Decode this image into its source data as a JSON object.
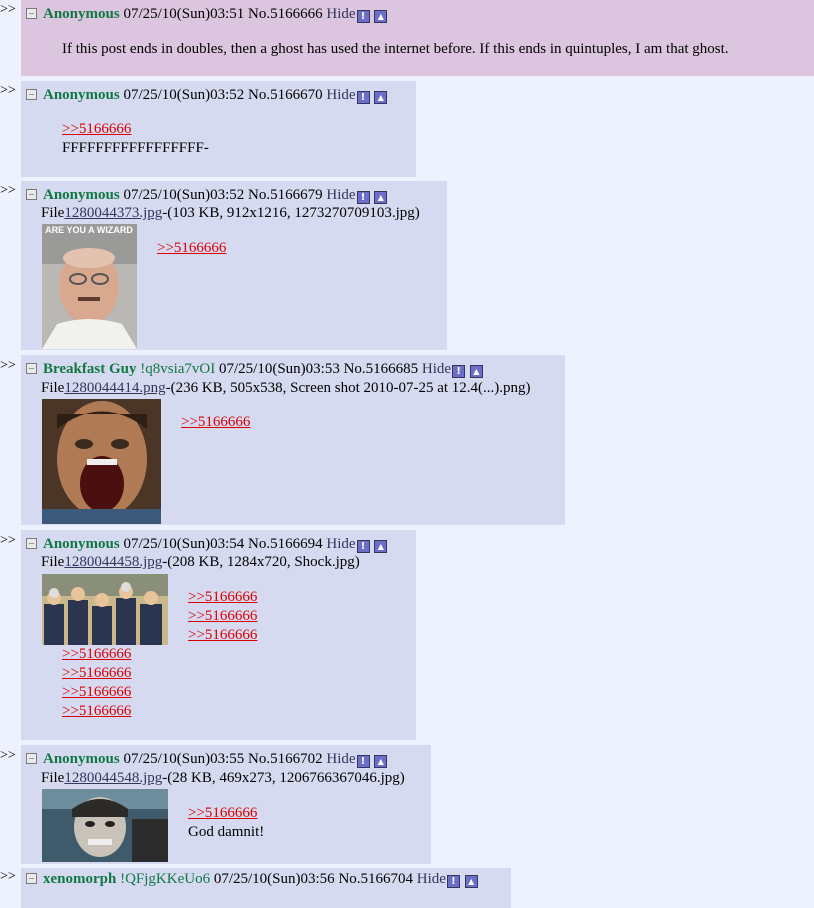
{
  "arrow": ">>",
  "hide_label": "Hide",
  "file_prefix": "File",
  "icons": {
    "report": "report-icon",
    "quick_reply": "quick-reply-icon",
    "checkbox": "delete-checkbox"
  },
  "posts": [
    {
      "name": "Anonymous",
      "date": "07/25/10(Sun)03:51",
      "no": "No.5166666",
      "lines": [
        "If this post ends in doubles, then a ghost has used the internet before. If this ends in quintuples, I am that ghost."
      ]
    },
    {
      "name": "Anonymous",
      "date": "07/25/10(Sun)03:52",
      "no": "No.5166670",
      "quote": ">>5166666",
      "lines": [
        "FFFFFFFFFFFFFFFFF-"
      ]
    },
    {
      "name": "Anonymous",
      "date": "07/25/10(Sun)03:52",
      "no": "No.5166679",
      "file_link": "1280044373.jpg",
      "file_info": "-(103 KB, 912x1216, 1273270709103.jpg)",
      "thumb_text": "ARE YOU A WIZARD",
      "quote": ">>5166666"
    },
    {
      "name": "Breakfast Guy",
      "trip": "!q8vsia7vOI",
      "date": "07/25/10(Sun)03:53",
      "no": "No.5166685",
      "file_link": "1280044414.png",
      "file_info": "-(236 KB, 505x538, Screen shot 2010-07-25 at 12.4(...).png)",
      "quote": ">>5166666"
    },
    {
      "name": "Anonymous",
      "date": "07/25/10(Sun)03:54",
      "no": "No.5166694",
      "file_link": "1280044458.jpg",
      "file_info": "-(208 KB, 1284x720, Shock.jpg)",
      "quotes": [
        ">>5166666",
        ">>5166666",
        ">>5166666",
        ">>5166666",
        ">>5166666",
        ">>5166666",
        ">>5166666"
      ]
    },
    {
      "name": "Anonymous",
      "date": "07/25/10(Sun)03:55",
      "no": "No.5166702",
      "file_link": "1280044548.jpg",
      "file_info": "-(28 KB, 469x273, 1206766367046.jpg)",
      "quote": ">>5166666",
      "lines": [
        "God damnit!"
      ]
    },
    {
      "name": "xenomorph",
      "trip": "!QFjgKKeUo6",
      "date": "07/25/10(Sun)03:56",
      "no": "No.5166704"
    }
  ]
}
